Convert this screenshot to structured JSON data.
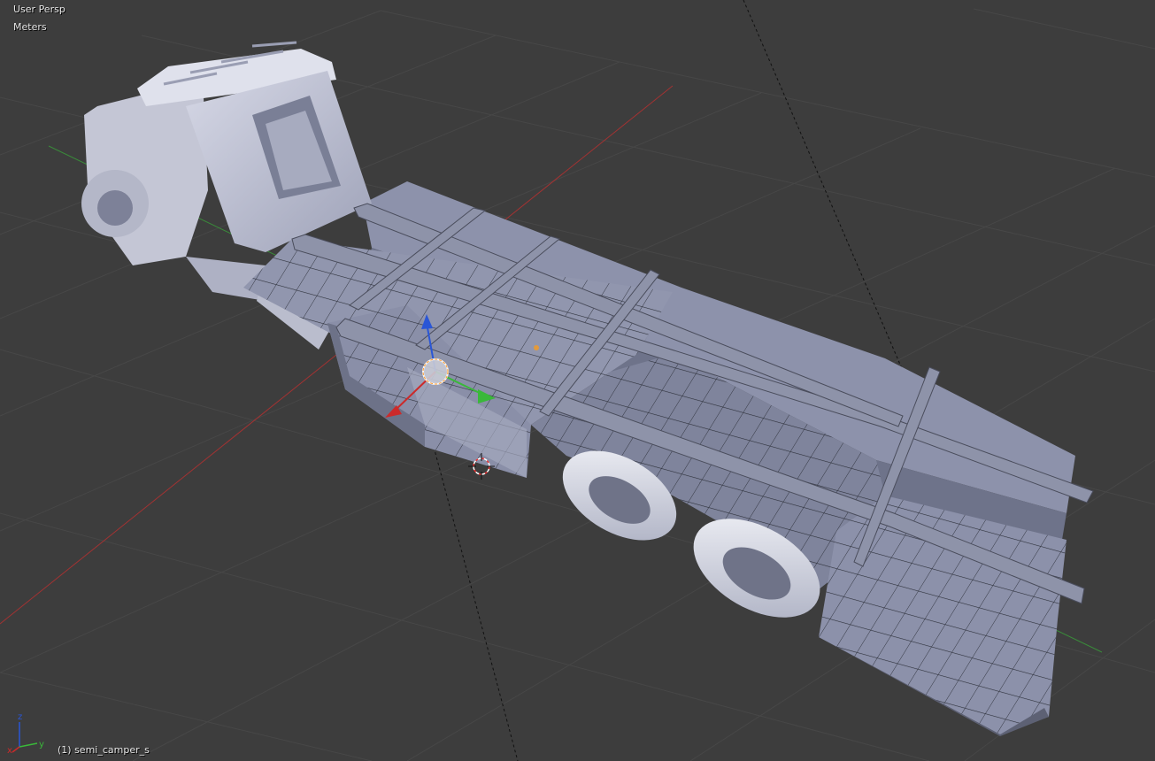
{
  "viewport": {
    "view_name": "User Persp",
    "units": "Meters",
    "active_object": "(1) semi_camper_s"
  },
  "axis_widget": {
    "x_label": "x",
    "y_label": "y",
    "z_label": "z"
  },
  "colors": {
    "background": "#3d3d3d",
    "grid": "#474747",
    "x_axis": "#b03232",
    "y_axis": "#3a9a3a",
    "z_axis": "#2a56d6",
    "mesh_fill": "#8a8fa8",
    "mesh_light": "#bfc2d2",
    "mesh_dark": "#5c6073",
    "text": "#e6e6e6"
  }
}
